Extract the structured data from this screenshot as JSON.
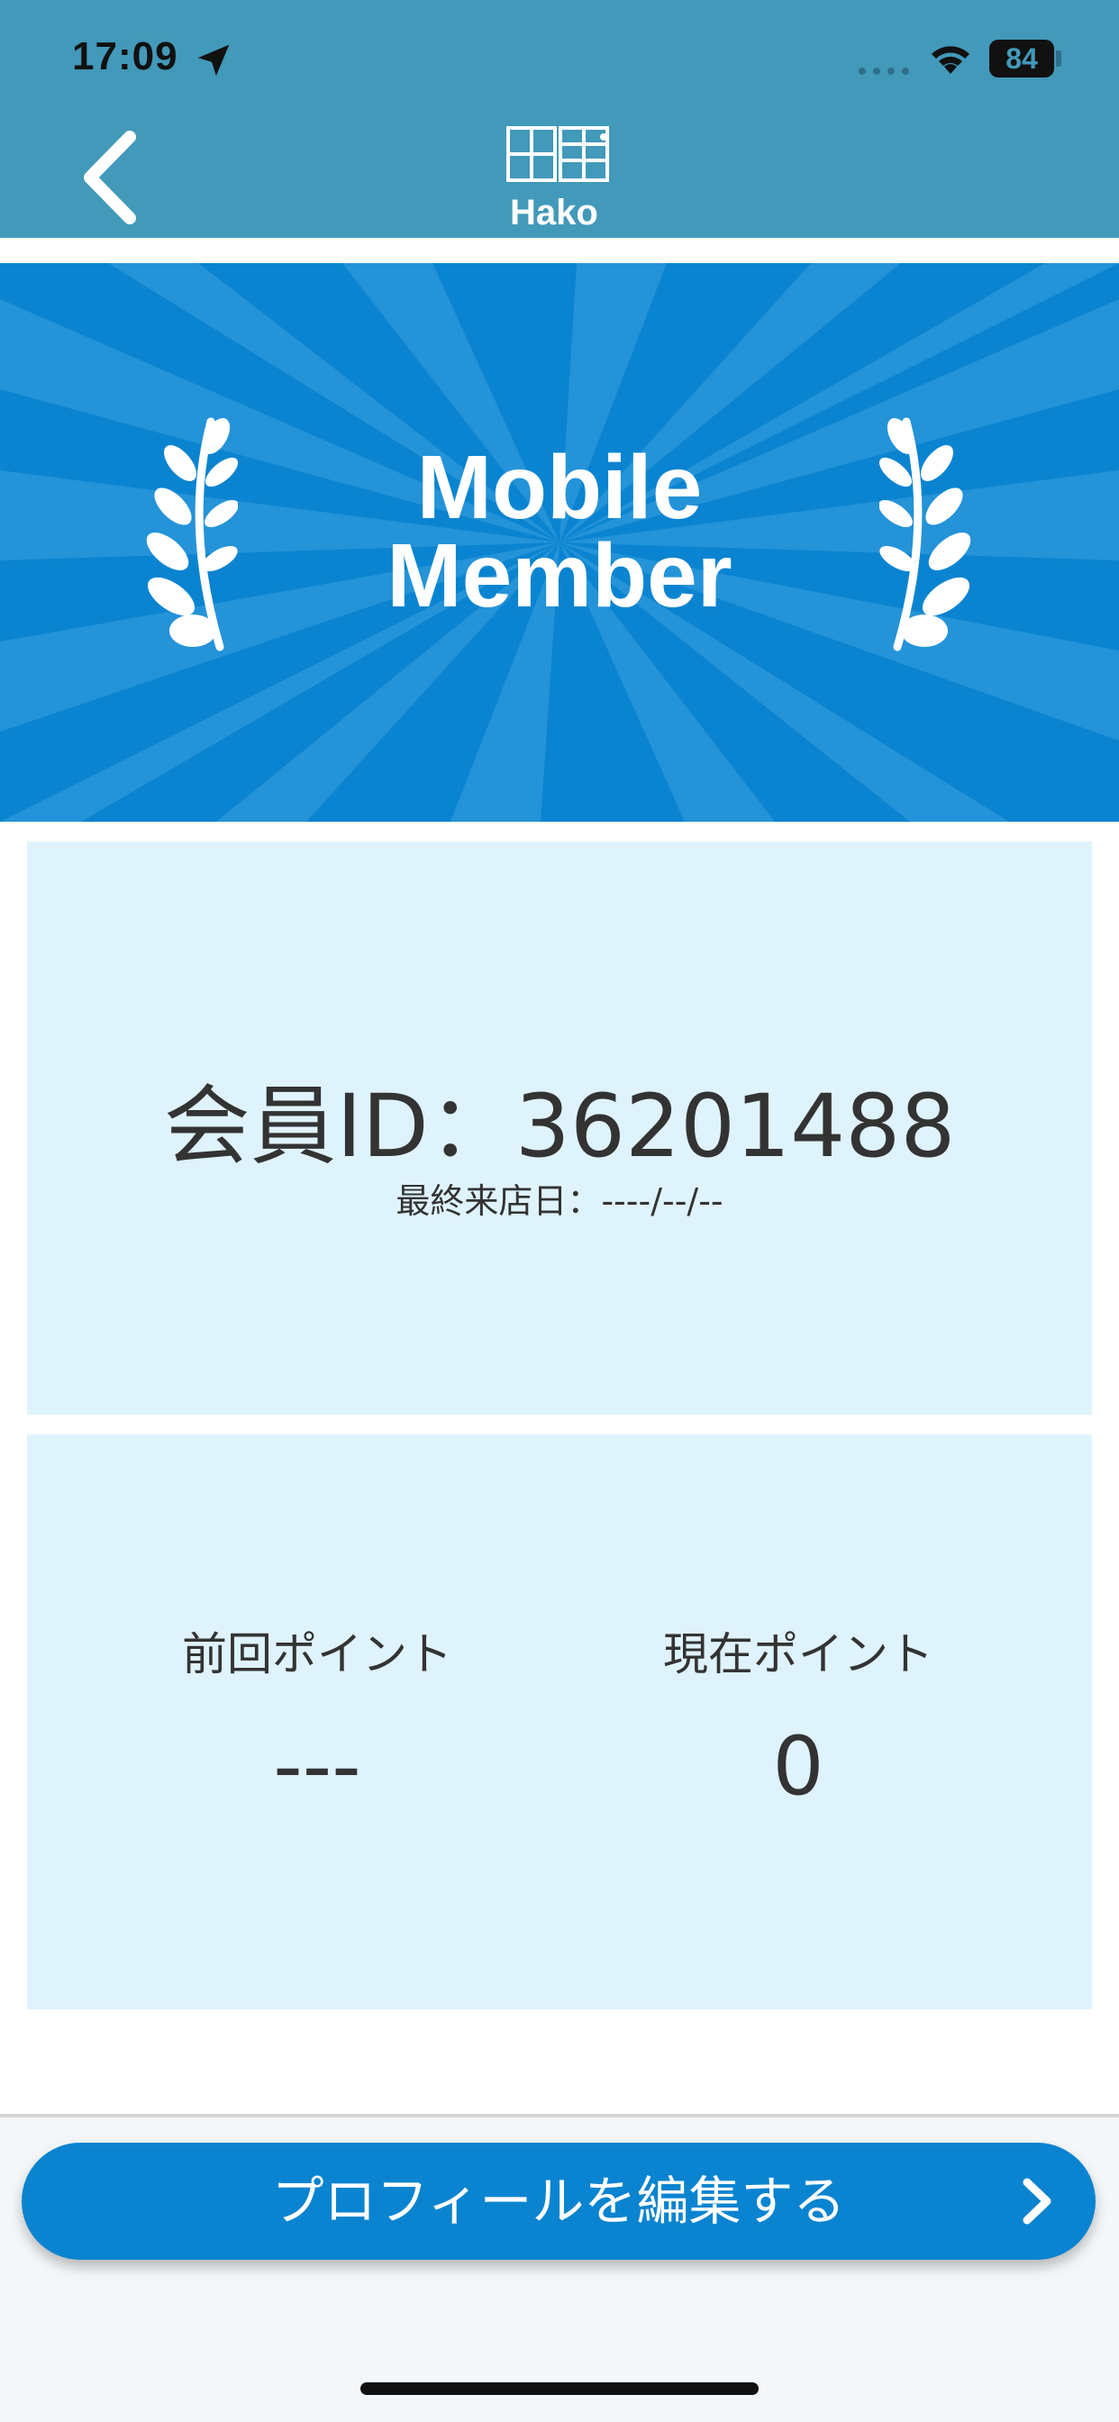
{
  "status_bar": {
    "time": "17:09",
    "battery": "84"
  },
  "header": {
    "logo_text": "Hako",
    "colors": {
      "header_bg": "#4299b9"
    }
  },
  "banner": {
    "title_line1": "Mobile",
    "title_line2": "Member",
    "colors": {
      "bg": "#0a84d0"
    }
  },
  "member_card": {
    "member_id": "会員ID：36201488",
    "last_visit": "最終来店日：----/--/--"
  },
  "points": {
    "previous_label": "前回ポイント",
    "previous_value": "---",
    "current_label": "現在ポイント",
    "current_value": "0"
  },
  "footer": {
    "edit_profile_label": "プロフィールを編集する"
  },
  "icons": {
    "back": "chevron-left-icon",
    "location": "location-arrow-icon",
    "wifi": "wifi-icon",
    "laurel": "laurel-icon",
    "chevron": "chevron-right-icon"
  }
}
